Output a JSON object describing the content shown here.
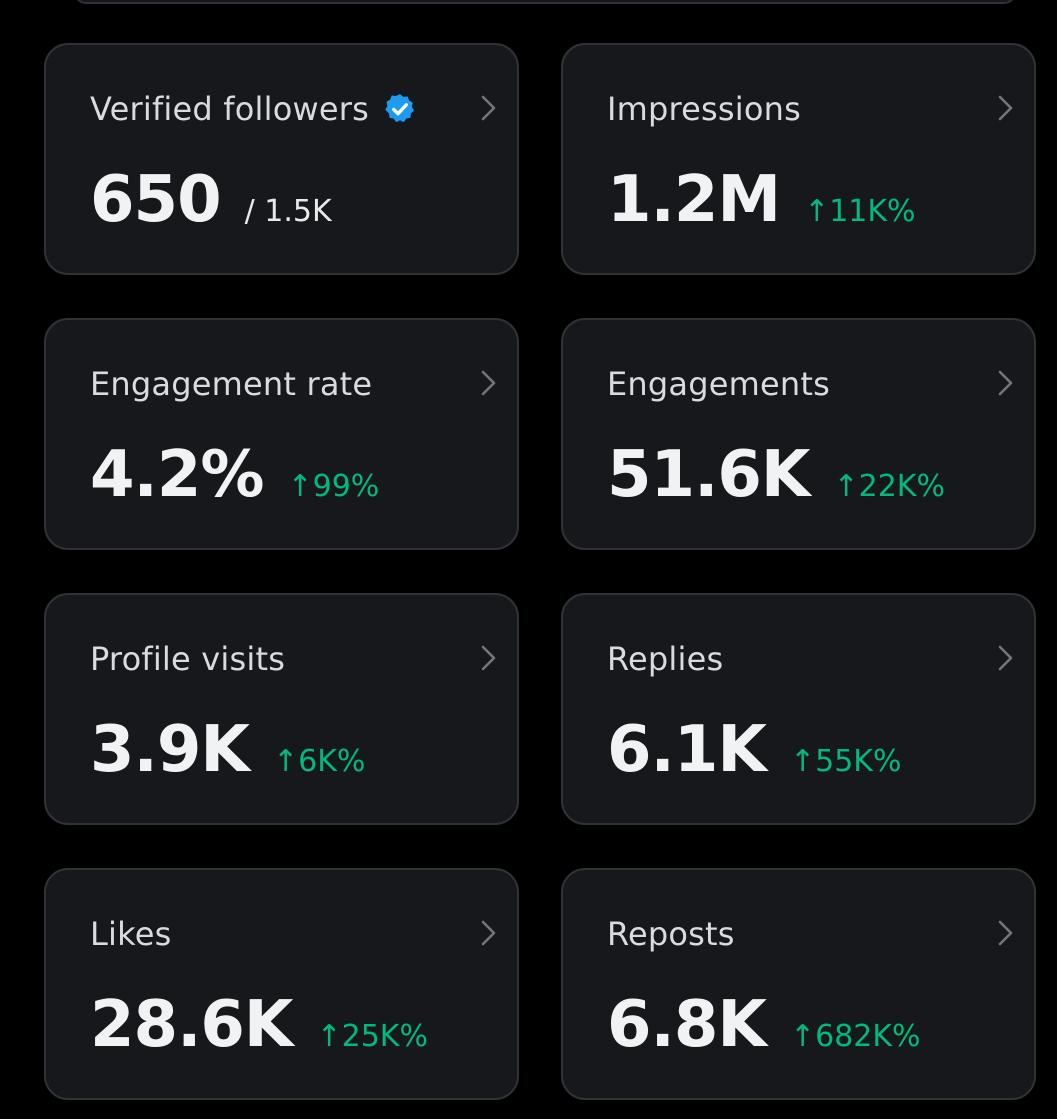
{
  "colors": {
    "background": "#000000",
    "card_background": "#16181c",
    "card_border": "#2f3336",
    "positive_change": "#00ba7c",
    "verified_badge": "#1d9bf0"
  },
  "icons": {
    "verified": "verified-badge-icon",
    "chevron": "chevron-right-icon"
  },
  "cards": [
    {
      "title": "Verified followers",
      "value": "650",
      "sub_total": "/ 1.5K",
      "verified": true
    },
    {
      "title": "Impressions",
      "value": "1.2M",
      "change": "↑11K%"
    },
    {
      "title": "Engagement rate",
      "value": "4.2%",
      "change": "↑99%"
    },
    {
      "title": "Engagements",
      "value": "51.6K",
      "change": "↑22K%"
    },
    {
      "title": "Profile visits",
      "value": "3.9K",
      "change": "↑6K%"
    },
    {
      "title": "Replies",
      "value": "6.1K",
      "change": "↑55K%"
    },
    {
      "title": "Likes",
      "value": "28.6K",
      "change": "↑25K%"
    },
    {
      "title": "Reposts",
      "value": "6.8K",
      "change": "↑682K%"
    }
  ]
}
